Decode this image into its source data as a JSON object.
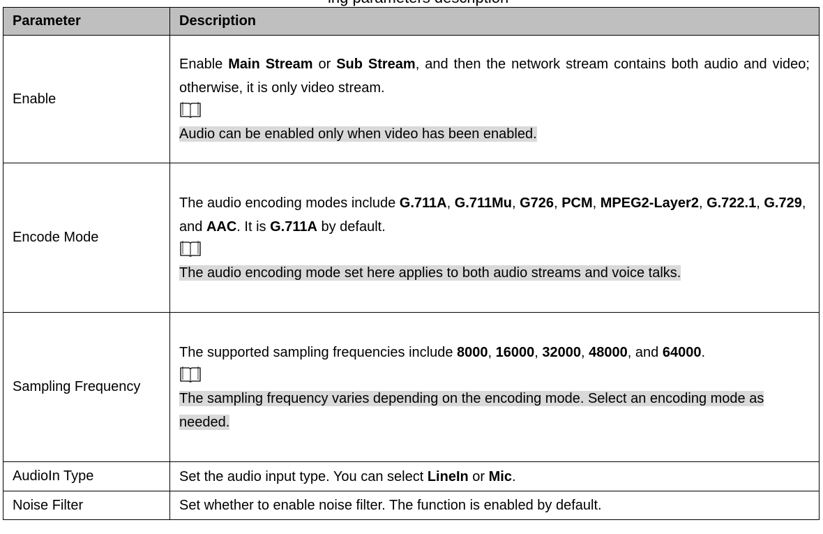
{
  "caption_fragment": "ing parameters description",
  "columns": {
    "parameter": "Parameter",
    "description": "Description"
  },
  "rows": [
    {
      "parameter": "Enable",
      "desc": [
        {
          "t": "Enable "
        },
        {
          "t": "Main Stream",
          "b": true
        },
        {
          "t": " or "
        },
        {
          "t": "Sub Stream",
          "b": true
        },
        {
          "t": ", and then the network stream contains both audio and video; otherwise, it is only video stream."
        }
      ],
      "note_icon": "book-icon",
      "note": "Audio can be enabled only when video has been enabled."
    },
    {
      "parameter": "Encode Mode",
      "desc": [
        {
          "t": "The audio encoding modes include "
        },
        {
          "t": "G.711A",
          "b": true
        },
        {
          "t": ", "
        },
        {
          "t": "G.711Mu",
          "b": true
        },
        {
          "t": ", "
        },
        {
          "t": "G726",
          "b": true
        },
        {
          "t": ", "
        },
        {
          "t": "PCM",
          "b": true
        },
        {
          "t": ", "
        },
        {
          "t": "MPEG2-Layer2",
          "b": true
        },
        {
          "t": ", "
        },
        {
          "t": "G.722.1",
          "b": true
        },
        {
          "t": ", "
        },
        {
          "t": "G.729",
          "b": true
        },
        {
          "t": ", and "
        },
        {
          "t": "AAC",
          "b": true
        },
        {
          "t": ". It is "
        },
        {
          "t": "G.711A",
          "b": true
        },
        {
          "t": " by default."
        }
      ],
      "note_icon": "book-icon",
      "note": "The audio encoding mode set here applies to both audio streams and voice talks."
    },
    {
      "parameter": "Sampling Frequency",
      "desc": [
        {
          "t": "The supported sampling frequencies include "
        },
        {
          "t": "8000",
          "b": true
        },
        {
          "t": ", "
        },
        {
          "t": "16000",
          "b": true
        },
        {
          "t": ", "
        },
        {
          "t": "32000",
          "b": true
        },
        {
          "t": ", "
        },
        {
          "t": "48000",
          "b": true
        },
        {
          "t": ", and "
        },
        {
          "t": "64000",
          "b": true
        },
        {
          "t": "."
        }
      ],
      "note_icon": "book-icon",
      "note": "The sampling frequency varies depending on the encoding mode. Select an encoding mode as needed."
    },
    {
      "parameter": "AudioIn Type",
      "desc": [
        {
          "t": "Set the audio input type. You can select "
        },
        {
          "t": "LineIn",
          "b": true
        },
        {
          "t": " or "
        },
        {
          "t": "Mic",
          "b": true
        },
        {
          "t": "."
        }
      ]
    },
    {
      "parameter": "Noise Filter",
      "desc": [
        {
          "t": "Set whether to enable noise filter. The function is enabled by default."
        }
      ]
    }
  ]
}
